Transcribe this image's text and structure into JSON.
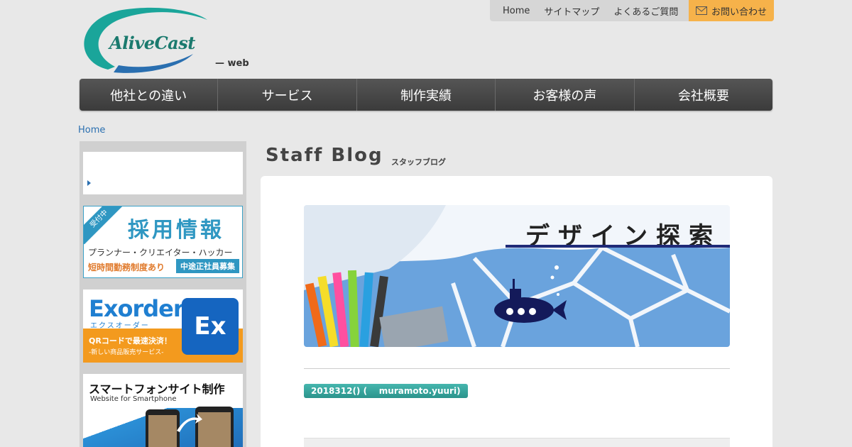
{
  "logo": {
    "text": "AliveCast",
    "sub": "— web"
  },
  "topnav": {
    "items": [
      "Home",
      "サイトマップ",
      "よくあるご質問"
    ],
    "contact": "お問い合わせ"
  },
  "mainnav": [
    "他社との違い",
    "サービス",
    "制作実績",
    "お客様の声",
    "会社概要"
  ],
  "breadcrumb": "Home",
  "sidebar": {
    "recruit": {
      "ribbon": "受付中",
      "title": "採用情報",
      "line1": "プランナー・クリエイター・ハッカー",
      "line2": "短時間勤務制度あり",
      "badge": "中途正社員募集"
    },
    "exorder": {
      "title": "Exorder",
      "kana": "エクスオーダー",
      "line1": "QRコードで最速決済！",
      "line2": "-新しい商品販売サービス-",
      "logo": "Ex"
    },
    "smart": {
      "title": "スマートフォンサイト制作",
      "sub": "Website for Smartphone"
    }
  },
  "content": {
    "title": "Staff Blog",
    "subtitle": "スタッフブログ",
    "hero_title": "デザイン探索",
    "tag": "2018312() (    muramoto.yuuri)"
  },
  "colors": {
    "accent_teal": "#2b948c",
    "contact_orange": "#f6b24a",
    "nav_dark": "#444444",
    "link_blue": "#2a6fb0"
  }
}
